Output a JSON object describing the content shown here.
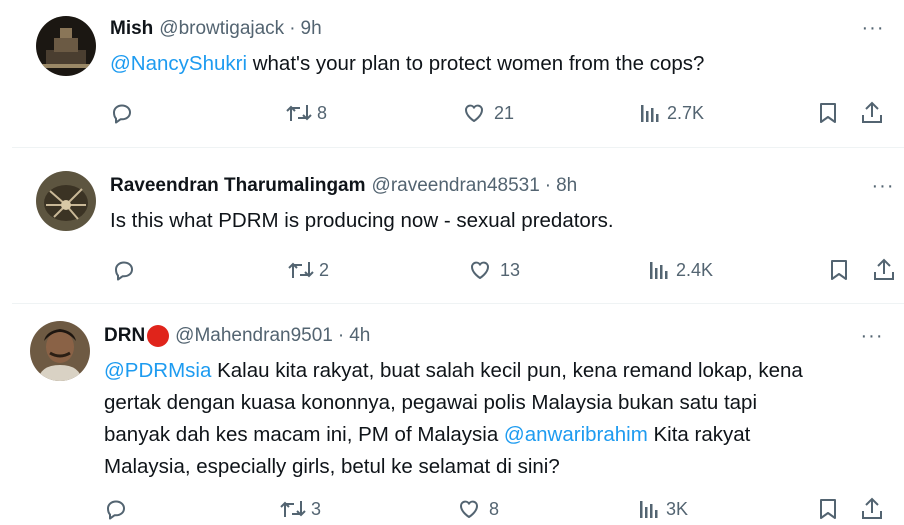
{
  "tweets": [
    {
      "name": "Mish",
      "handle": "@browtigajack",
      "sep": "·",
      "time": "9h",
      "mention1": "@NancyShukri",
      "text": " what's your plan to protect women from the cops?",
      "replies": "",
      "retweets": "8",
      "likes": "21",
      "views": "2.7K"
    },
    {
      "name": "Raveendran Tharumalingam",
      "handle": "@raveendran48531",
      "sep": "·",
      "time": "8h",
      "text": "Is this what PDRM is producing now - sexual predators.",
      "replies": "",
      "retweets": "2",
      "likes": "13",
      "views": "2.4K"
    },
    {
      "name": "DRN",
      "handle": "@Mahendran9501",
      "sep": "·",
      "time": "4h",
      "mention1": "@PDRMsia",
      "text_a": " Kalau kita rakyat, buat salah kecil pun, kena remand lokap, kena",
      "line2": "gertak dengan kuasa kononnya, pegawai polis Malaysia bukan satu tapi",
      "line3_a": "banyak dah kes macam ini, PM of Malaysia ",
      "mention2": "@anwaribrahim",
      "line3_b": " Kita rakyat",
      "line4": "Malaysia, especially girls, betul ke selamat di sini?",
      "replies": "",
      "retweets": "3",
      "likes": "8",
      "views": "3K"
    }
  ],
  "more_label": "···",
  "colors": {
    "link": "#1d9bf0",
    "muted": "#536471",
    "text": "#0f1419",
    "badge": "#e0241b"
  }
}
